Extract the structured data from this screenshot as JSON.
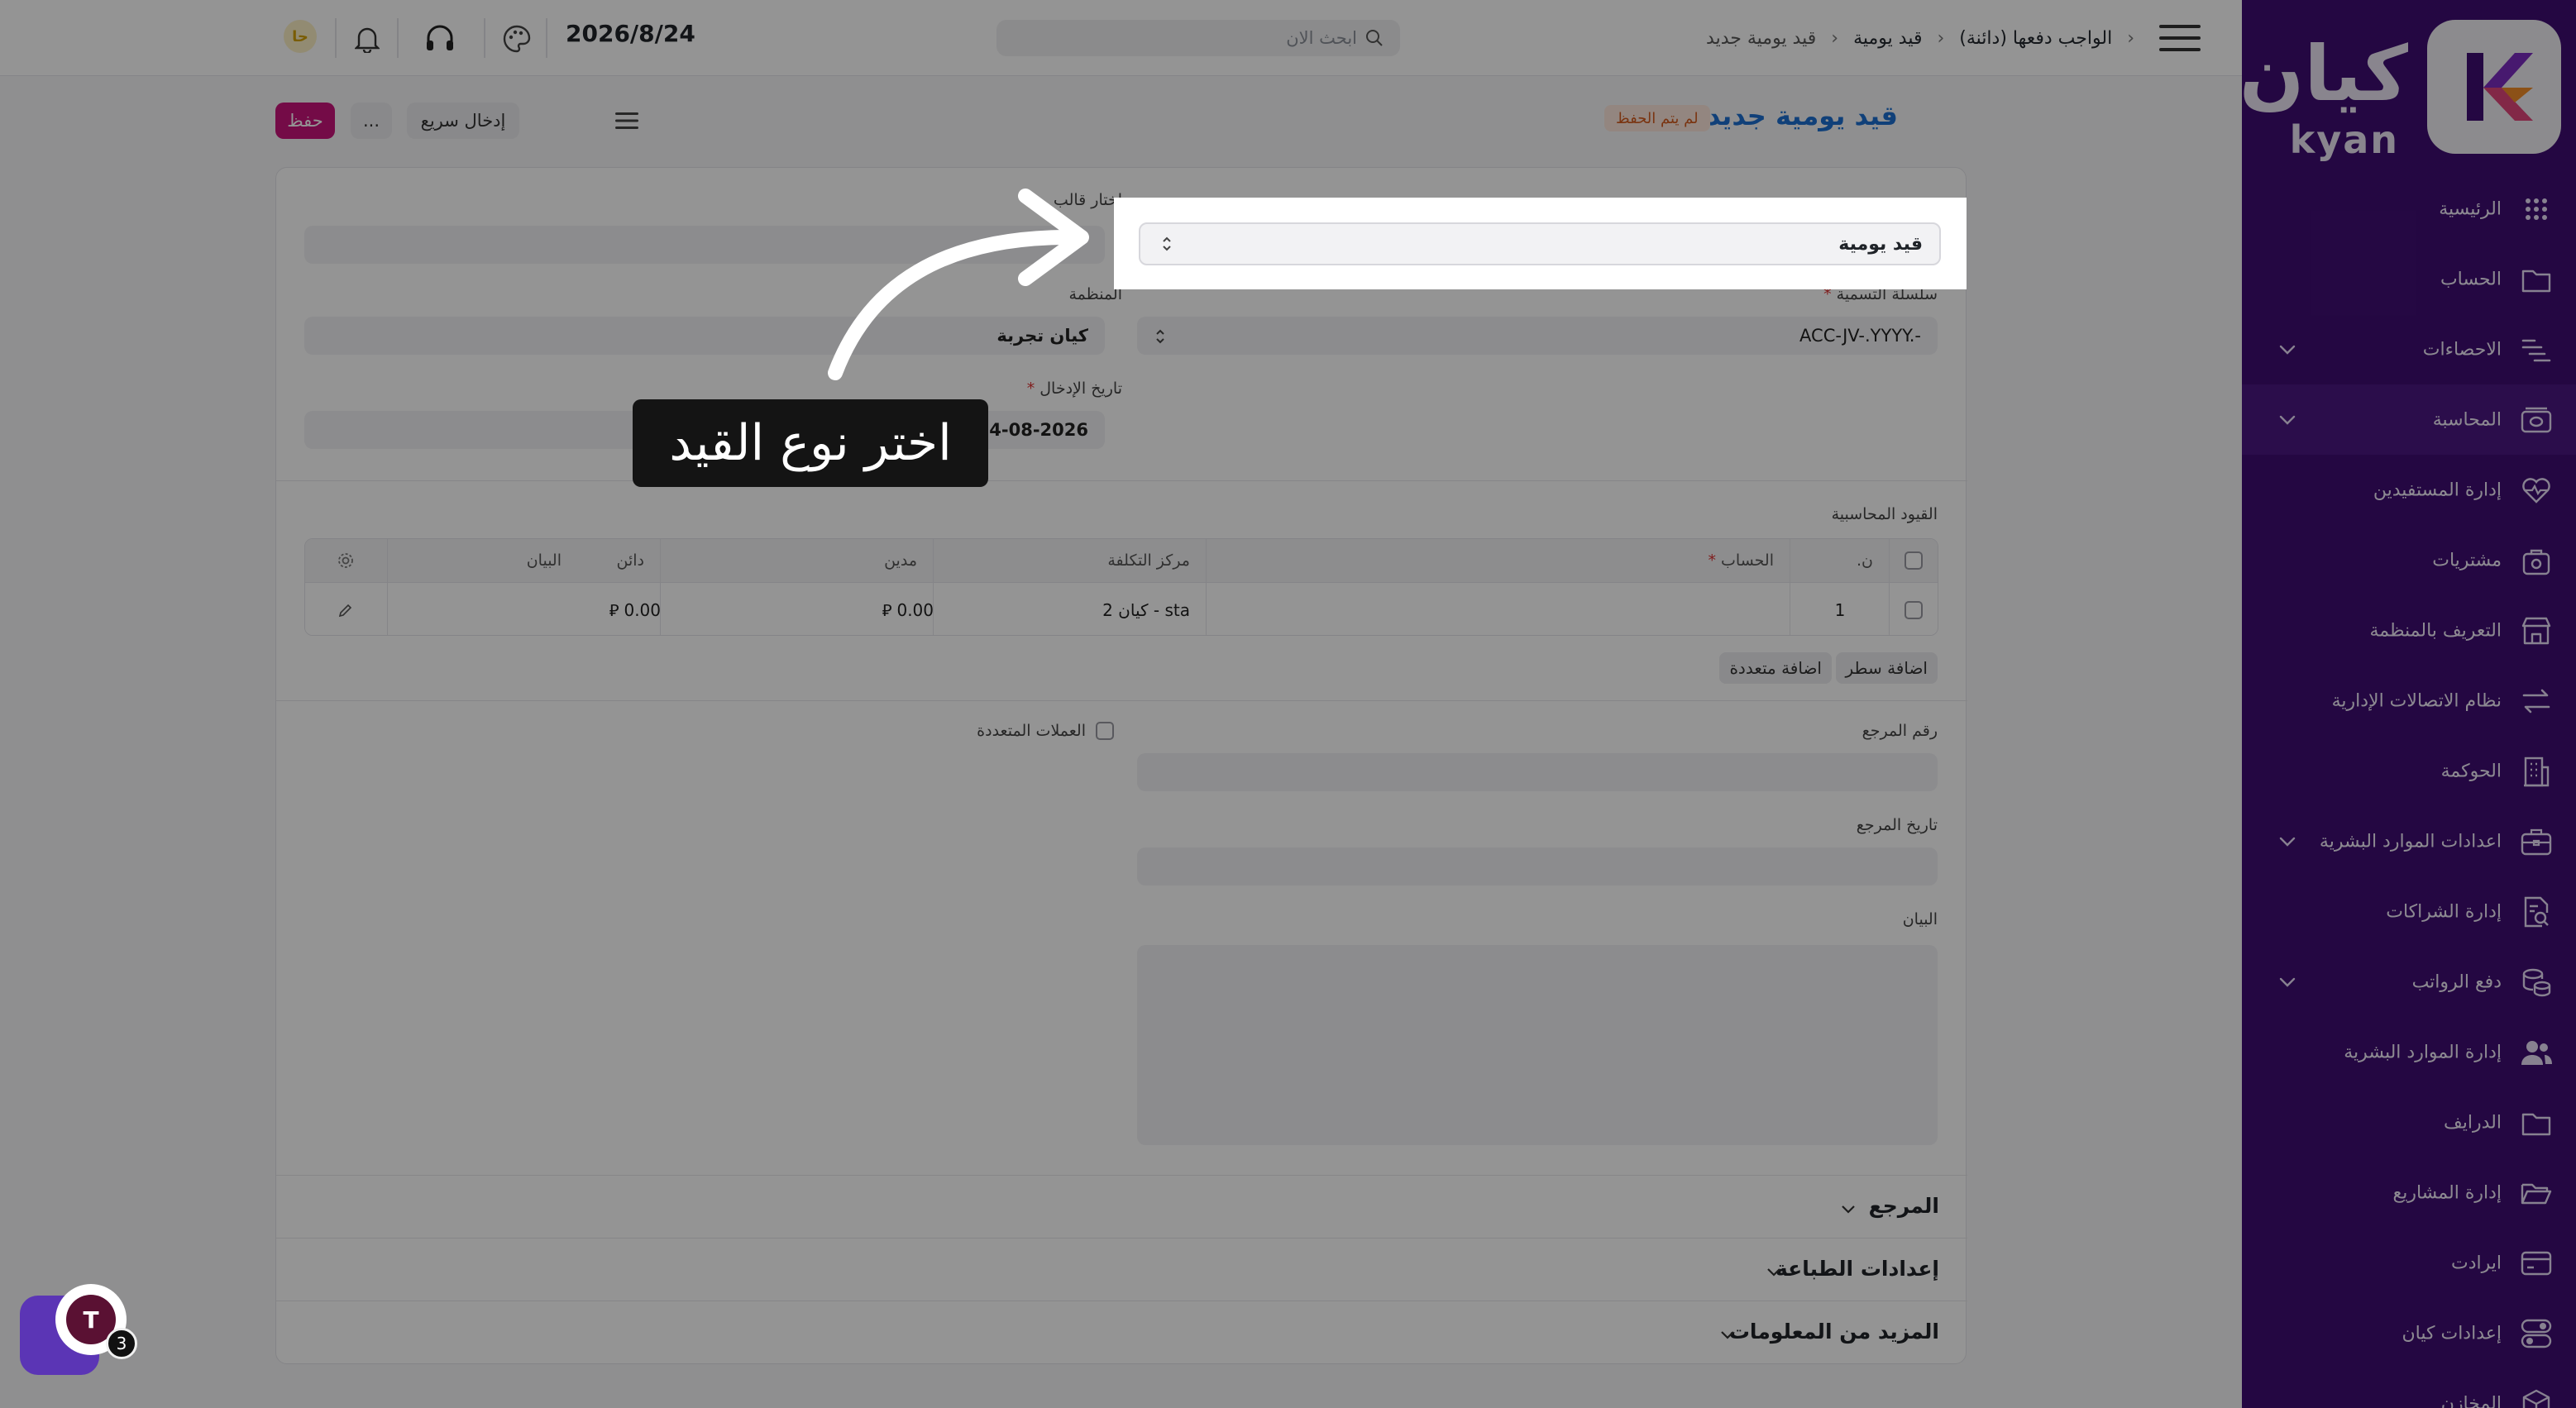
{
  "brand": {
    "name_ar": "كيان",
    "name_en": "kyan"
  },
  "sidebar": {
    "items": [
      {
        "label": "الرئيسية",
        "icon": "grid-icon",
        "chevron": false,
        "active": false
      },
      {
        "label": "الحساب",
        "icon": "folder-icon",
        "chevron": false,
        "active": false
      },
      {
        "label": "الاحصاءات",
        "icon": "stats-list-icon",
        "chevron": true,
        "active": false
      },
      {
        "label": "المحاسبة",
        "icon": "accounting-icon",
        "chevron": true,
        "active": true
      },
      {
        "label": "إدارة المستفيدين",
        "icon": "heart-pulse-icon",
        "chevron": false,
        "active": false
      },
      {
        "label": "مشتريات",
        "icon": "purchases-icon",
        "chevron": false,
        "active": false
      },
      {
        "label": "التعريف بالمنظمة",
        "icon": "store-icon",
        "chevron": false,
        "active": false
      },
      {
        "label": "نظام الاتصالات الإدارية",
        "icon": "arrows-exchange-icon",
        "chevron": false,
        "active": false
      },
      {
        "label": "الحوكمة",
        "icon": "building-icon",
        "chevron": false,
        "active": false
      },
      {
        "label": "اعدادات الموارد البشرية",
        "icon": "briefcase-icon",
        "chevron": true,
        "active": false
      },
      {
        "label": "إدارة الشراكات",
        "icon": "document-search-icon",
        "chevron": false,
        "active": false
      },
      {
        "label": "دفع الرواتب",
        "icon": "coins-icon",
        "chevron": true,
        "active": false
      },
      {
        "label": "إدارة الموارد البشرية",
        "icon": "users-icon",
        "chevron": false,
        "active": false
      },
      {
        "label": "الدرايف",
        "icon": "folder-icon",
        "chevron": false,
        "active": false
      },
      {
        "label": "إدارة المشاريع",
        "icon": "folder-open-icon",
        "chevron": false,
        "active": false
      },
      {
        "label": "ايرادت",
        "icon": "card-icon",
        "chevron": false,
        "active": false
      },
      {
        "label": "إعدادات كيان",
        "icon": "toggles-icon",
        "chevron": false,
        "active": false
      },
      {
        "label": "المخازن",
        "icon": "box-icon",
        "chevron": false,
        "active": false
      }
    ]
  },
  "topbar": {
    "breadcrumb": [
      "الواجب دفعها (دائنة)",
      "قيد يومية",
      "قيد يومية جديد"
    ],
    "search_placeholder": "ابحث الان",
    "date": "2026/8/24",
    "avatar_initials": "حا"
  },
  "page": {
    "title": "قيد يومية جديد",
    "status_badge": "لم يتم الحفظ",
    "save_label": "حفظ",
    "more_label": "...",
    "quick_entry_label": "إدخال سريع"
  },
  "form": {
    "entry_type_value": "قيد يومية",
    "naming_series_label": "سلسلة التسمية",
    "naming_series_value": "ACC-JV-.YYYY.-",
    "template_label": "اختار قالب",
    "organization_label": "المنظمة",
    "organization_value": "كيان تجربة",
    "posting_date_label": "تاريخ الإدخال",
    "posting_date_value": "24-08-2026",
    "accounting_entries_label": "القيود المحاسبية",
    "table": {
      "headers": [
        "ن.",
        "الحساب",
        "مركز التكلفة",
        "مدين",
        "دائن",
        "البيان"
      ],
      "rows": [
        {
          "no": "1",
          "account": "",
          "cost_center": "sta - كيان 2",
          "debit": "0.00",
          "credit": "0.00",
          "remark": ""
        }
      ],
      "currency_symbol": "⃁"
    },
    "add_row_label": "اضافة سطر",
    "add_multiple_label": "اضافة متعددة",
    "reference_no_label": "رقم المرجع",
    "multi_currency_label": "العملات المتعددة",
    "reference_date_label": "تاريخ المرجع",
    "remark_label": "البيان"
  },
  "sections": [
    "المرجع",
    "إعدادات الطباعة",
    "المزيد من المعلومات"
  ],
  "tour": {
    "tooltip_text": "اختر نوع القيد"
  },
  "chat": {
    "count": "3",
    "logo_letter": "T"
  },
  "colors": {
    "sidebar": "#3f0d73",
    "accent": "#c8137a",
    "title": "#1c6fd1"
  }
}
